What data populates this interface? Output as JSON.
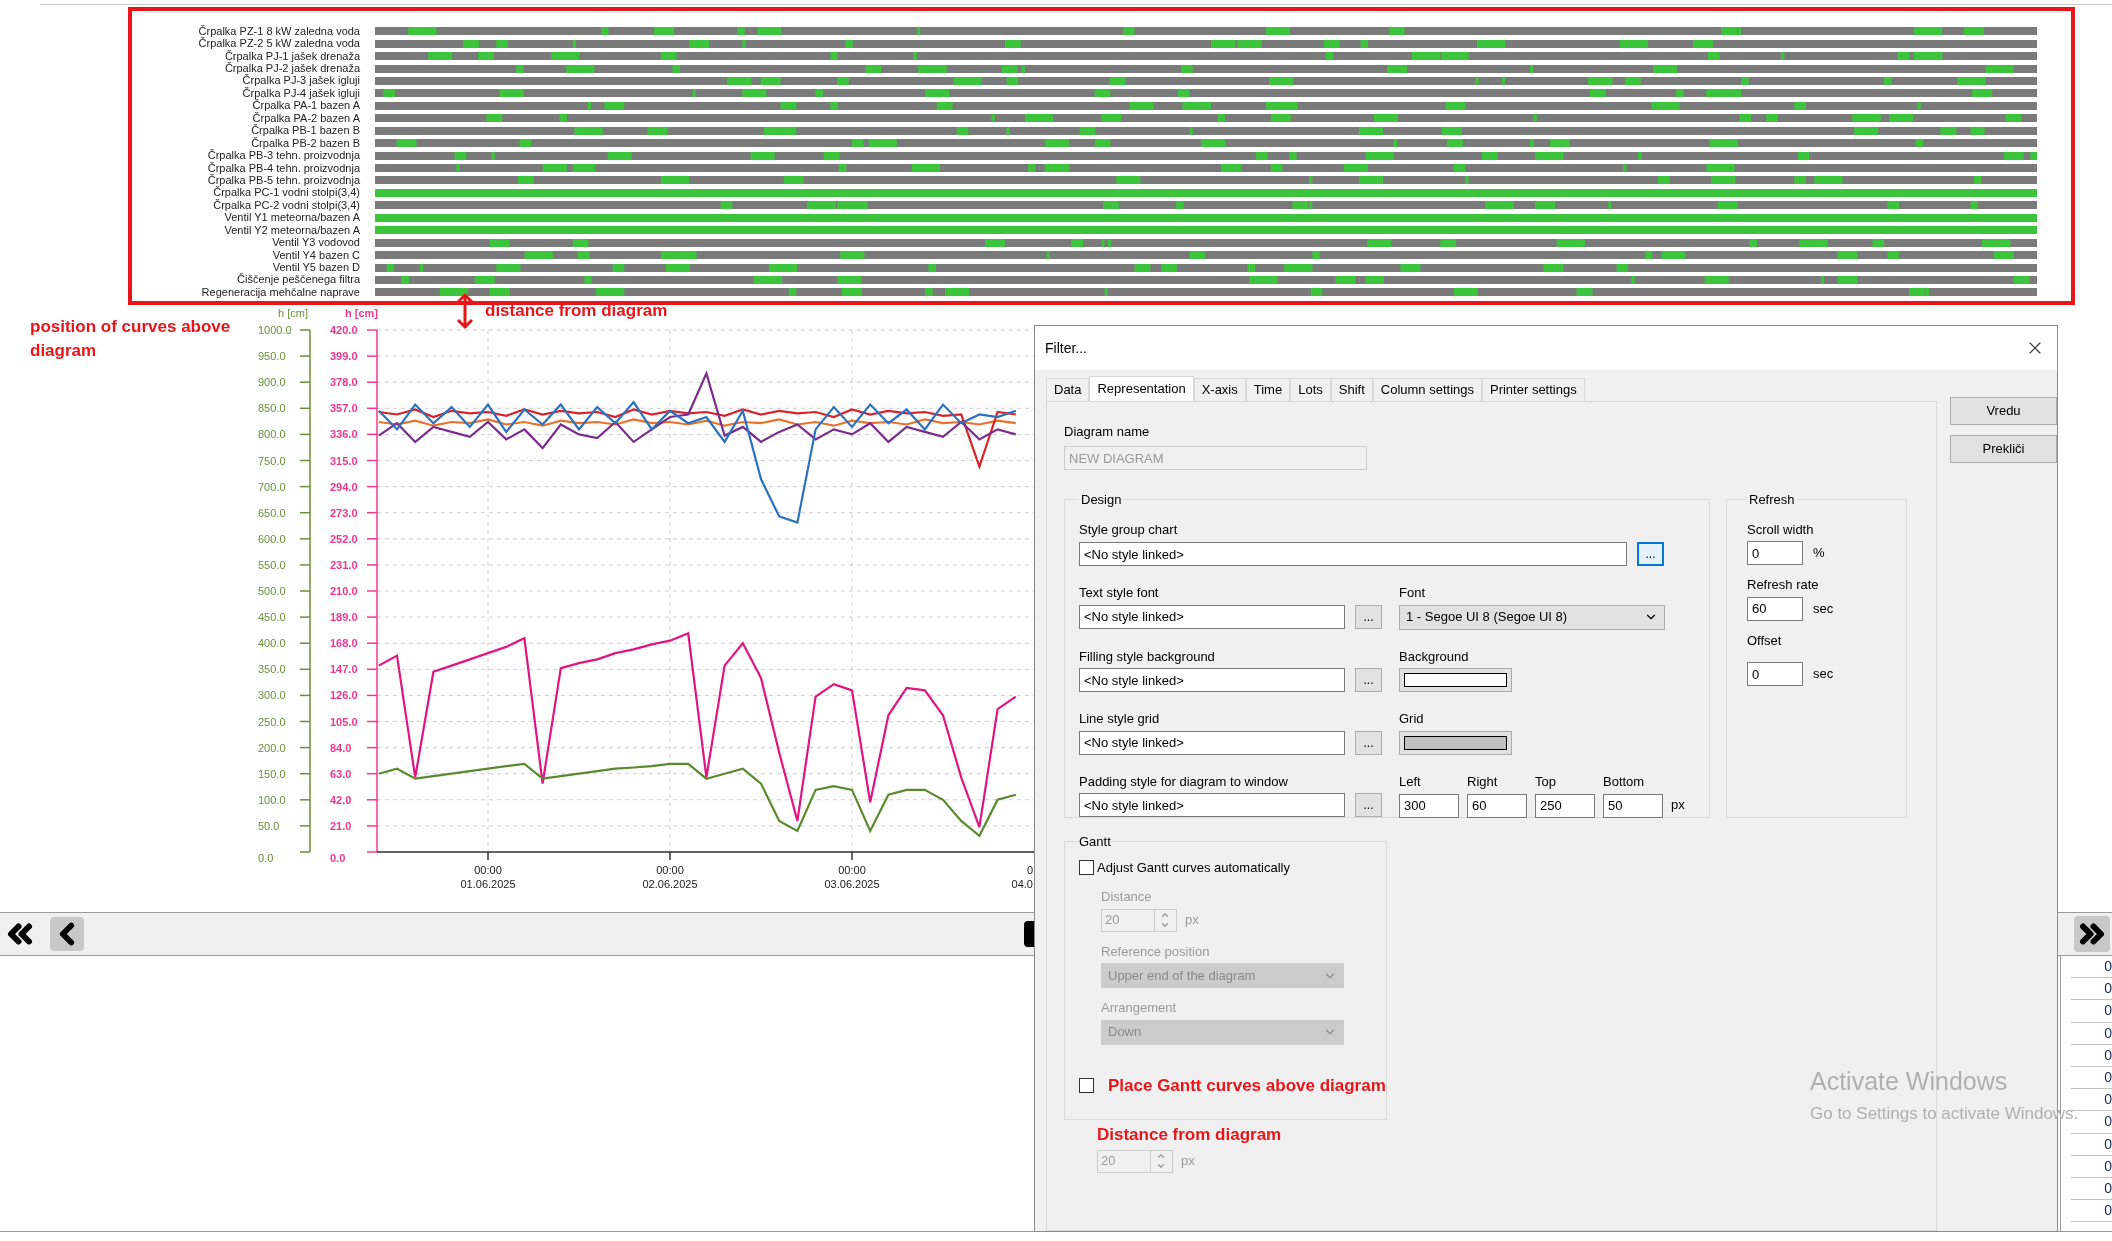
{
  "gantt": {
    "rows": [
      {
        "label": "Črpalka PZ-1 8 kW zaledna voda",
        "full": false
      },
      {
        "label": "Črpalka PZ-2 5 kW zaledna voda",
        "full": false
      },
      {
        "label": "Črpalka PJ-1 jašek drenaža",
        "full": false
      },
      {
        "label": "Črpalka PJ-2 jašek drenaža",
        "full": false
      },
      {
        "label": "Črpalka PJ-3 jašek igluji",
        "full": false
      },
      {
        "label": "Črpalka PJ-4 jašek igluji",
        "full": false
      },
      {
        "label": "Črpalka PA-1 bazen A",
        "full": false
      },
      {
        "label": "Črpalka PA-2 bazen A",
        "full": false
      },
      {
        "label": "Črpalka PB-1 bazen B",
        "full": false
      },
      {
        "label": "Črpalka PB-2 bazen B",
        "full": false
      },
      {
        "label": "Črpalka PB-3 tehn. proizvodnja",
        "full": false
      },
      {
        "label": "Črpalka PB-4 tehn. proizvodnja",
        "full": false
      },
      {
        "label": "Črpalka PB-5 tehn. proizvodnja",
        "full": false
      },
      {
        "label": "Črpalka PC-1 vodni stolpi(3,4)",
        "full": true
      },
      {
        "label": "Črpalka PC-2 vodni stolpi(3,4)",
        "full": false
      },
      {
        "label": "Ventil Y1 meteorna/bazen A",
        "full": true
      },
      {
        "label": "Ventil Y2 meteorna/bazen A",
        "full": true
      },
      {
        "label": "Ventil Y3 vodovod",
        "full": false
      },
      {
        "label": "Ventil Y4 bazen C",
        "full": false
      },
      {
        "label": "Ventil Y5 bazen D",
        "full": false
      },
      {
        "label": "Čiščenje peščenega filtra",
        "full": false
      },
      {
        "label": "Regeneracija mehčalne naprave",
        "full": false
      }
    ]
  },
  "notes": {
    "curves_position": "position of curves above diagram",
    "distance": "distance from diagram"
  },
  "chart": {
    "chart_data": {
      "type": "line",
      "categories": [
        null,
        null,
        null,
        null,
        null,
        null,
        "00:00 01.06.2025",
        null,
        null,
        null,
        null,
        null,
        null,
        null,
        null,
        null,
        "00:00 02.06.2025",
        null,
        null,
        null,
        null,
        null,
        null,
        null,
        null,
        null,
        "00:00 03.06.2025",
        null,
        null,
        null,
        null,
        null,
        null,
        null,
        null,
        null
      ],
      "ylim": [
        0,
        420
      ],
      "yticks": [
        {
          "value": 0,
          "label": "0.0"
        },
        {
          "value": 21,
          "label": "21.0"
        },
        {
          "value": 42,
          "label": "42.0"
        },
        {
          "value": 63,
          "label": "63.0"
        },
        {
          "value": 84,
          "label": "84.0"
        },
        {
          "value": 105,
          "label": "105.0"
        },
        {
          "value": 126,
          "label": "126.0"
        },
        {
          "value": 147,
          "label": "147.0"
        },
        {
          "value": 168,
          "label": "168.0"
        },
        {
          "value": 189,
          "label": "189.0"
        },
        {
          "value": 210,
          "label": "210.0"
        },
        {
          "value": 231,
          "label": "231.0"
        },
        {
          "value": 252,
          "label": "252.0"
        },
        {
          "value": 273,
          "label": "273.0"
        },
        {
          "value": 294,
          "label": "294.0"
        },
        {
          "value": 315,
          "label": "315.0"
        },
        {
          "value": 336,
          "label": "336.0"
        },
        {
          "value": 357,
          "label": "357.0"
        },
        {
          "value": 378,
          "label": "378.0"
        },
        {
          "value": 399,
          "label": "399.0"
        },
        {
          "value": 420,
          "label": "420.0"
        }
      ],
      "grid": true,
      "series": [
        {
          "color": "#e8722a",
          "values": [
            346,
            344,
            347,
            343,
            346,
            345,
            348,
            344,
            346,
            343,
            347,
            345,
            346,
            344,
            348,
            345,
            346,
            344,
            347,
            343,
            346,
            345,
            348,
            344,
            346,
            343,
            347,
            345,
            346,
            344,
            348,
            345,
            346,
            344,
            347,
            345
          ]
        },
        {
          "color": "#d8232a",
          "values": [
            354,
            352,
            356,
            350,
            355,
            353,
            354,
            351,
            356,
            352,
            355,
            353,
            354,
            350,
            356,
            352,
            355,
            353,
            354,
            351,
            356,
            352,
            355,
            353,
            354,
            350,
            356,
            352,
            355,
            353,
            354,
            351,
            352,
            310,
            354,
            352
          ]
        },
        {
          "color": "#7b2d8e",
          "values": [
            335,
            345,
            330,
            342,
            338,
            334,
            346,
            332,
            340,
            325,
            344,
            336,
            333,
            346,
            330,
            340,
            350,
            352,
            385,
            335,
            342,
            330,
            338,
            344,
            332,
            340,
            336,
            345,
            330,
            342,
            338,
            334,
            346,
            332,
            340,
            336
          ]
        },
        {
          "color": "#2a72c0",
          "values": [
            355,
            340,
            360,
            345,
            358,
            342,
            360,
            338,
            356,
            344,
            360,
            340,
            358,
            345,
            362,
            340,
            355,
            345,
            350,
            330,
            355,
            300,
            270,
            265,
            340,
            358,
            342,
            360,
            345,
            356,
            340,
            360,
            345,
            352,
            350,
            355
          ]
        },
        {
          "color": "#e0157f",
          "values": [
            150,
            158,
            60,
            145,
            150,
            155,
            160,
            165,
            172,
            55,
            148,
            152,
            155,
            160,
            163,
            167,
            170,
            176,
            60,
            150,
            168,
            140,
            80,
            25,
            125,
            135,
            130,
            40,
            110,
            132,
            130,
            110,
            60,
            20,
            115,
            125
          ]
        },
        {
          "color": "#5a8a2e",
          "values": [
            63,
            67,
            59,
            61,
            63,
            65,
            67,
            69,
            71,
            59,
            61,
            63,
            65,
            67,
            68,
            69,
            71,
            71,
            59,
            63,
            67,
            55,
            25,
            17,
            50,
            53,
            50,
            17,
            46,
            50,
            50,
            42,
            25,
            13,
            42,
            46
          ]
        }
      ]
    },
    "cut_date_label": "0 04.0",
    "secondary_ticks": [
      "1000.0",
      "950.0",
      "900.0",
      "850.0",
      "800.0",
      "750.0",
      "700.0",
      "650.0",
      "600.0",
      "550.0",
      "500.0",
      "450.0",
      "400.0",
      "350.0",
      "300.0",
      "250.0",
      "200.0",
      "150.0",
      "100.0",
      "50.0",
      "0.0"
    ]
  },
  "axis_titles": [
    {
      "text": "h [cm]",
      "color": "#6b8f3a"
    },
    {
      "text": "h [cm]",
      "color": "#f0388f"
    }
  ],
  "table": {
    "cells": [
      "0",
      "0",
      "0",
      "0",
      "0",
      "0",
      "0",
      "0",
      "0",
      "0",
      "0",
      "0"
    ]
  },
  "dialog": {
    "title": "Filter...",
    "tabs": [
      {
        "label": "Data",
        "selected": false
      },
      {
        "label": "Representation",
        "selected": true
      },
      {
        "label": "X-axis",
        "selected": false
      },
      {
        "label": "Time",
        "selected": false
      },
      {
        "label": "Lots",
        "selected": false
      },
      {
        "label": "Shift",
        "selected": false
      },
      {
        "label": "Column settings",
        "selected": false
      },
      {
        "label": "Printer settings",
        "selected": false
      }
    ],
    "buttons": [
      "Vredu",
      "Prekliči"
    ],
    "diagram_name": {
      "label": "Diagram name",
      "value": "NEW DIAGRAM",
      "disabled": true
    },
    "design": {
      "legend": "Design",
      "style_group_chart": {
        "label": "Style group chart",
        "value": "<No style linked>",
        "button": "..."
      },
      "rows": [
        {
          "kind": "select",
          "label": "Text style font",
          "value": "<No style linked>",
          "button": "...",
          "right_label": "Font",
          "right_value": "1 - Segoe UI 8 (Segoe UI 8)"
        },
        {
          "kind": "swatch",
          "label": "Filling style background",
          "value": "<No style linked>",
          "button": "...",
          "right_label": "Background",
          "color": "#ffffff"
        },
        {
          "kind": "swatch",
          "label": "Line style grid",
          "value": "<No style linked>",
          "button": "...",
          "right_label": "Grid",
          "color": "#c0c0c0"
        }
      ],
      "padding": {
        "label": "Padding style for diagram to window",
        "value": "<No style linked>",
        "button": "...",
        "unit": "px",
        "fields": [
          {
            "label": "Left",
            "value": "300"
          },
          {
            "label": "Right",
            "value": "60"
          },
          {
            "label": "Top",
            "value": "250"
          },
          {
            "label": "Bottom",
            "value": "50"
          }
        ]
      }
    },
    "refresh": {
      "legend": "Refresh",
      "fields": [
        {
          "label": "Scroll width",
          "value": "0",
          "unit": "%"
        },
        {
          "label": "Refresh rate",
          "value": "60",
          "unit": "sec"
        },
        {
          "label": "Offset",
          "value": "0",
          "unit": "sec"
        }
      ]
    },
    "gantt": {
      "legend": "Gantt",
      "auto": {
        "label": "Adjust Gantt curves automatically",
        "checked": false
      },
      "distance": {
        "label": "Distance",
        "value": "20",
        "unit": "px",
        "disabled": true
      },
      "reference": {
        "label": "Reference position",
        "value": "Upper end of the diagram",
        "disabled": true
      },
      "arrangement": {
        "label": "Arrangement",
        "value": "Down",
        "disabled": true
      },
      "place_above": {
        "label": "Place Gantt curves above diagram",
        "checked": false
      },
      "above_distance": {
        "label": "Distance from diagram",
        "value": "20",
        "unit": "px",
        "disabled": true
      }
    }
  },
  "os_notice": {
    "title": "Activate Windows",
    "text": "Go to Settings to activate Windows."
  }
}
